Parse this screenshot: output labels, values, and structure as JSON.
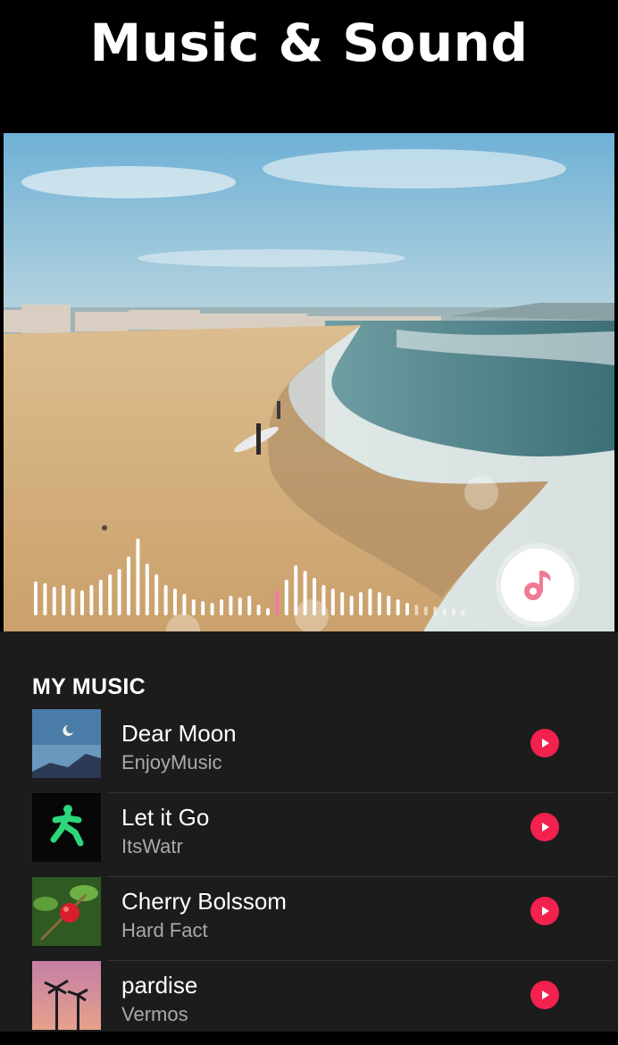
{
  "header": {
    "title": "Music & Sound"
  },
  "preview": {
    "music_button_icon": "music-note-icon"
  },
  "my_music": {
    "section_title": "MY MUSIC",
    "tracks": [
      {
        "title": "Dear Moon",
        "artist": "EnjoyMusic",
        "icon": "play-icon"
      },
      {
        "title": "Let it Go",
        "artist": "ItsWatr",
        "icon": "play-icon"
      },
      {
        "title": "Cherry Bolssom",
        "artist": "Hard Fact",
        "icon": "play-icon"
      },
      {
        "title": "pardise",
        "artist": "Vermos",
        "icon": "play-icon"
      }
    ]
  },
  "colors": {
    "accent": "#f2214d",
    "panel": "#1c1c1d",
    "subtext": "#a9a9ac"
  }
}
